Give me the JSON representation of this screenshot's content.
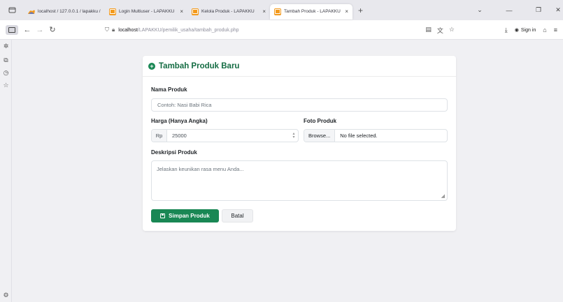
{
  "browser": {
    "tabs": [
      {
        "label": "localhost / 127.0.0.1 / lapakku / ×",
        "favicon": "phpmyadmin-icon",
        "active": false
      },
      {
        "label": "Login Multiuser - LAPAKKU",
        "favicon": "lapakku-icon",
        "active": false
      },
      {
        "label": "Kelola Produk - LAPAKKU",
        "favicon": "lapakku-icon",
        "active": false
      },
      {
        "label": "Tambah Produk - LAPAKKU",
        "favicon": "lapakku-icon",
        "active": true
      }
    ],
    "tab_close": "×",
    "new_tab": "+",
    "url_host": "localhost",
    "url_path": "/LAPAKKU/pemilik_usaha/tambah_produk.php",
    "sign_in": "Sign in"
  },
  "form": {
    "title": "Tambah Produk Baru",
    "name_label": "Nama Produk",
    "name_placeholder": "Contoh: Nasi Babi Rica",
    "price_label": "Harga (Hanya Angka)",
    "price_prefix": "Rp",
    "price_placeholder": "25000",
    "photo_label": "Foto Produk",
    "browse_label": "Browse...",
    "no_file_label": "No file selected.",
    "desc_label": "Deskripsi Produk",
    "desc_placeholder": "Jelaskan keunikan rasa menu Anda...",
    "save_label": "Simpan Produk",
    "cancel_label": "Batal"
  },
  "colors": {
    "primary_green": "#198754",
    "title_green": "#146c43",
    "favicon_orange": "#f39a1d",
    "page_bg": "#f0f0f3"
  }
}
